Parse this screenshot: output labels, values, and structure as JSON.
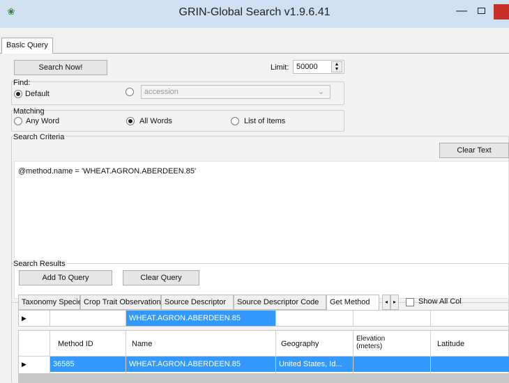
{
  "window": {
    "title": "GRIN-Global Search v1.9.6.41",
    "app_icon": "grin-global-icon",
    "controls": [
      "minimize-icon",
      "maximize-icon",
      "close-icon"
    ]
  },
  "tabs": {
    "basic_query": "Basic Query"
  },
  "toolbar": {
    "search_now": "Search Now!",
    "limit_label": "Limit:",
    "limit_value": "50000"
  },
  "find": {
    "label": "Find:",
    "options": [
      {
        "label": "Default",
        "checked": true
      },
      {
        "label": "",
        "checked": false
      }
    ],
    "combo_value": "accession"
  },
  "matching": {
    "label": "Matching",
    "options": [
      {
        "label": "Any Word",
        "checked": false
      },
      {
        "label": "All Words",
        "checked": true
      },
      {
        "label": "List of Items",
        "checked": false
      }
    ]
  },
  "criteria": {
    "label": "Search Criteria",
    "clear_text": "Clear Text",
    "query_text": "@method.name = 'WHEAT.AGRON.ABERDEEN.85'"
  },
  "results": {
    "label": "Search Results",
    "add_to_query": "Add To Query",
    "clear_query": "Clear Query",
    "result_tabs": [
      {
        "label": "Taxonomy Species",
        "active": false
      },
      {
        "label": "Crop Trait Observation",
        "active": false
      },
      {
        "label": "Source Descriptor",
        "active": false
      },
      {
        "label": "Source Descriptor Code",
        "active": false
      },
      {
        "label": "Get Method",
        "active": true
      }
    ],
    "show_all_columns": "Show All Col",
    "filter_row": {
      "name": "WHEAT.AGRON.ABERDEEN.85"
    },
    "columns": [
      "Method ID",
      "Name",
      "Geography",
      "Elevation (meters)",
      "Latitude"
    ],
    "rows": [
      {
        "method_id": "36585",
        "name": "WHEAT.AGRON.ABERDEEN.85",
        "geography": "United States, Id...",
        "elevation": "",
        "latitude": ""
      }
    ]
  }
}
